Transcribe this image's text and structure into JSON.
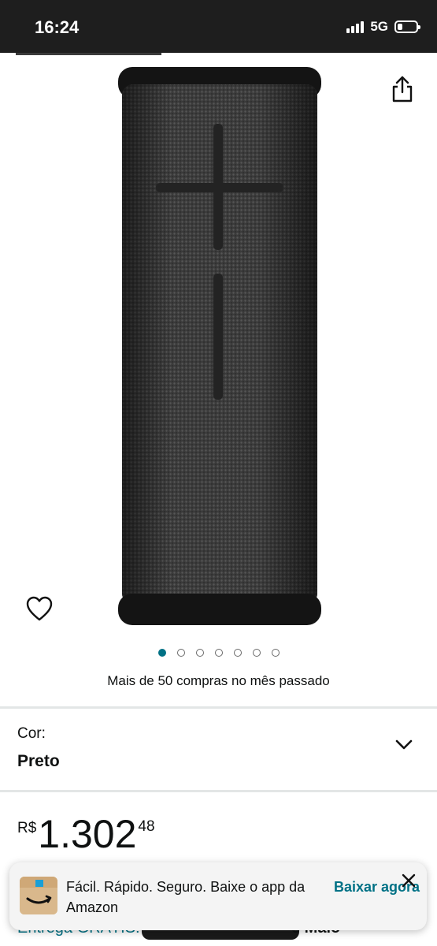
{
  "status_bar": {
    "time": "16:24",
    "network": "5G",
    "battery_level": 0.25
  },
  "product": {
    "image_name": "ultimate-ears-megaboom-speaker",
    "carousel": {
      "total": 7,
      "active": 0
    },
    "sales_note": "Mais de 50 compras no mês passado"
  },
  "variant": {
    "label": "Cor:",
    "value": "Preto"
  },
  "price": {
    "currency": "R$",
    "whole": "1.302",
    "fraction": "48"
  },
  "delivery": {
    "text_partial": "Entrega GRÁTIS:",
    "text_tail": "e Maio"
  },
  "app_banner": {
    "message": "Fácil. Rápido. Seguro. Baixe o app da Amazon",
    "cta": "Baixar agora"
  },
  "icons": [
    "share-icon",
    "heart-icon",
    "chevron-down-icon",
    "close-icon",
    "amazon-logo-icon",
    "signal-icon",
    "battery-icon"
  ],
  "colors": {
    "accent": "#007185",
    "status_bar": "#1e1e1e"
  }
}
